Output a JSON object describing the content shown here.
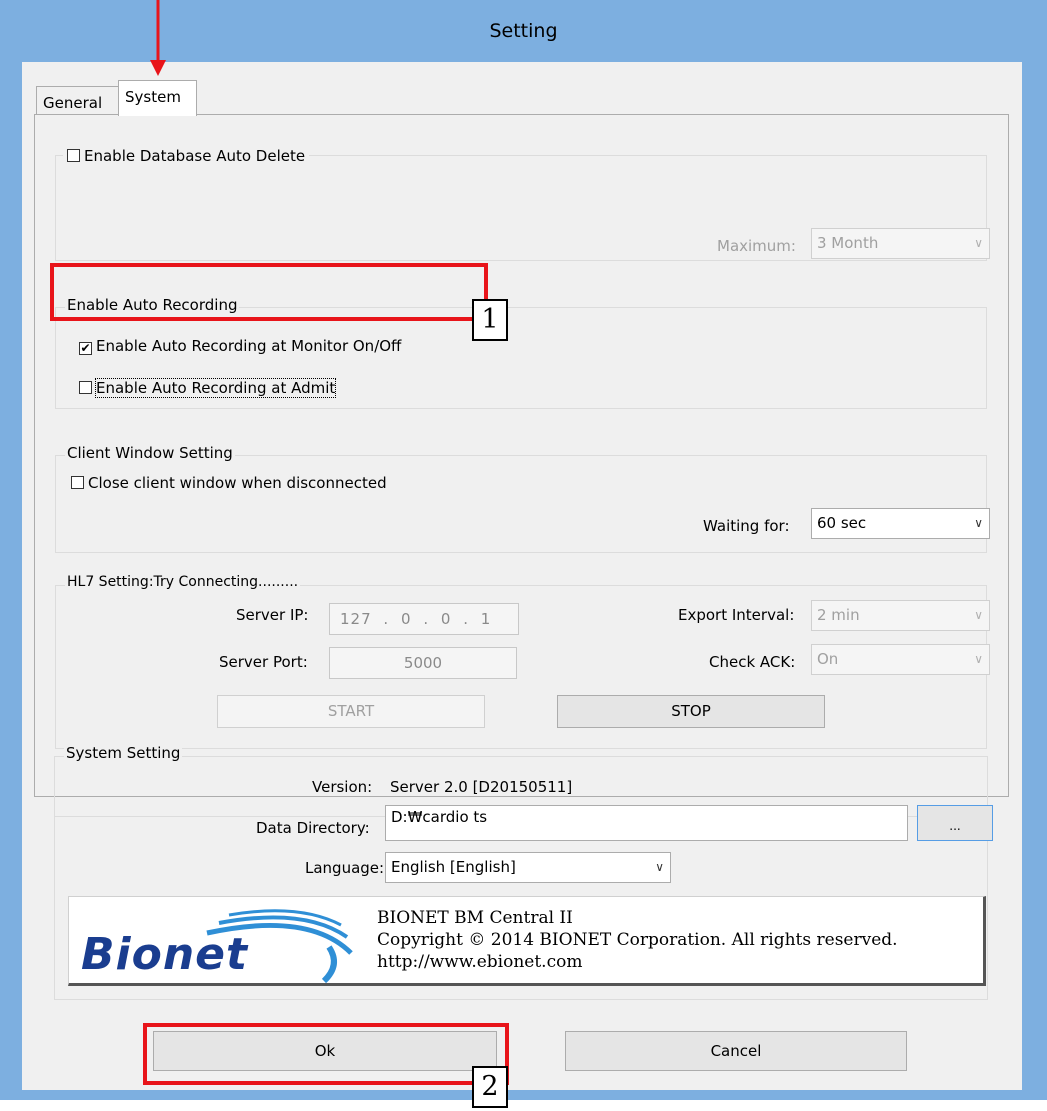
{
  "window": {
    "title": "Setting"
  },
  "tabs": [
    {
      "label": "General"
    },
    {
      "label": "System"
    }
  ],
  "db_group": {
    "checkbox_label": "Enable Database Auto Delete",
    "checked": false,
    "maximum_label": "Maximum:",
    "maximum_value": "3 Month"
  },
  "auto_rec_group": {
    "title": "Enable Auto Recording",
    "monitor_label": "Enable Auto Recording at Monitor On/Off",
    "monitor_checked": true,
    "admit_label": "Enable Auto Recording at Admit",
    "admit_checked": false
  },
  "client_group": {
    "title": "Client Window Setting",
    "close_label": "Close client window when disconnected",
    "close_checked": false,
    "waiting_label": "Waiting for:",
    "waiting_value": "60 sec"
  },
  "hl7_group": {
    "title": "HL7 Setting:Try Connecting.........",
    "server_ip_label": "Server IP:",
    "server_ip_parts": [
      "127",
      ".",
      "0",
      ".",
      "0",
      ".",
      "1"
    ],
    "server_port_label": "Server Port:",
    "server_port_value": "5000",
    "export_interval_label": "Export Interval:",
    "export_interval_value": "2 min",
    "check_ack_label": "Check ACK:",
    "check_ack_value": "On",
    "start_label": "START",
    "stop_label": "STOP"
  },
  "system_group": {
    "title": "System Setting",
    "version_label": "Version:",
    "version_value": "Server 2.0 [D20150511]",
    "data_dir_label": "Data Directory:",
    "data_dir_value": "D:₩cardio ts",
    "browse_label": "...",
    "language_label": "Language:",
    "language_value": "English [English]"
  },
  "about": {
    "logo_text": "Bionet",
    "product": "BIONET BM Central II",
    "copyright": "Copyright © 2014 BIONET Corporation. All rights reserved.",
    "url": "http://www.ebionet.com"
  },
  "footer": {
    "ok_label": "Ok",
    "cancel_label": "Cancel"
  },
  "annotations": {
    "badge_1": "1",
    "badge_2": "2"
  },
  "colors": {
    "frame": "#7dafe0",
    "highlight": "#e8141a",
    "logo_blue": "#1a3d8f"
  }
}
